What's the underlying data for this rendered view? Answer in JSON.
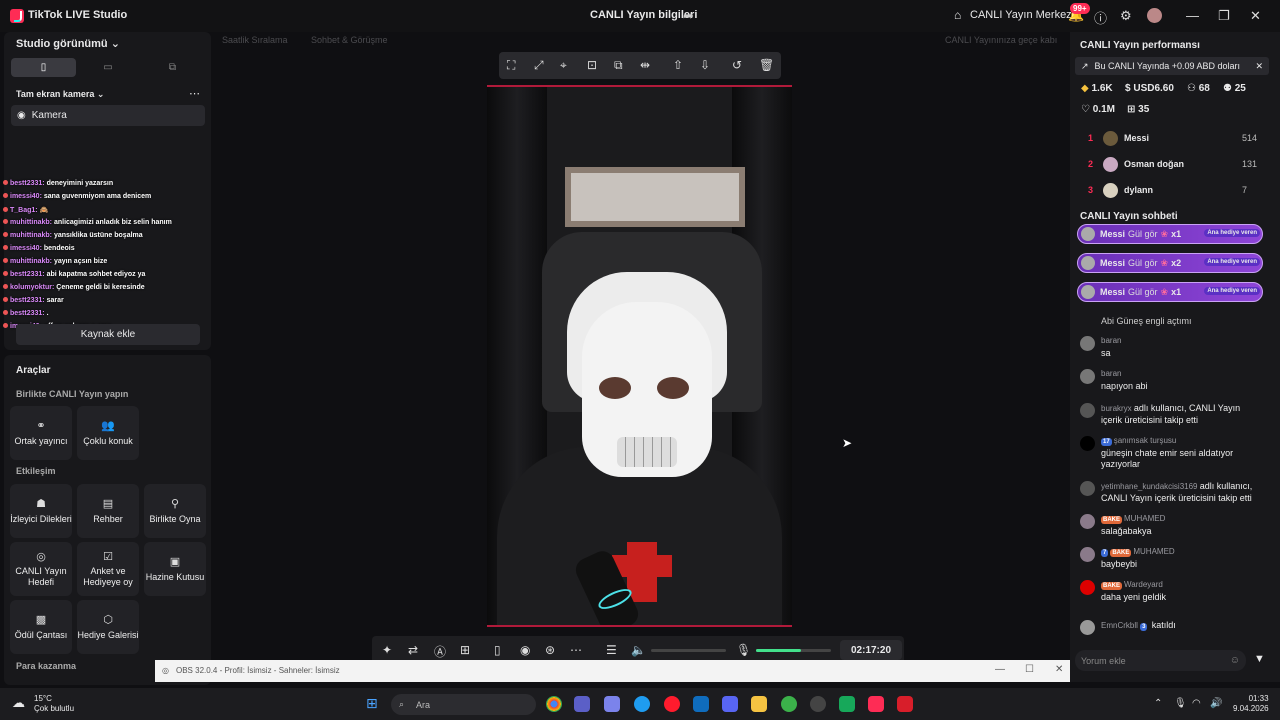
{
  "titlebar": {
    "app_name": "TikTok LIVE Studio",
    "center_title": "CANLI Yayın bilgileri",
    "home_label": "CANLI Yayın Merkezi",
    "notif_badge": "99+"
  },
  "left": {
    "studio_view": "Studio görünümü",
    "camera_mode": "Tam ekran kamera",
    "source_camera": "Kamera",
    "add_source": "Kaynak ekle",
    "overlay_chat": [
      {
        "user": "bestt2331:",
        "text": "deneyimini yazarsın"
      },
      {
        "user": "imessi40:",
        "text": "sana guvenmiyom ama denicem"
      },
      {
        "user": "T_Bag1:",
        "text": "🙈"
      },
      {
        "user": "muhittinakb:",
        "text": "anlicagimizi anladık biz selin hanım"
      },
      {
        "user": "muhittinakb:",
        "text": "yansıklika üstüne boşalma"
      },
      {
        "user": "imessi40:",
        "text": "bendeois"
      },
      {
        "user": "muhittinakb:",
        "text": "yayın açsın bize"
      },
      {
        "user": "bestt2331:",
        "text": "abi kapatma sohbet ediyoz ya"
      },
      {
        "user": "kolumyoktur:",
        "text": "Çeneme geldi bi keresinde"
      },
      {
        "user": "bestt2331:",
        "text": "sarar"
      },
      {
        "user": "bestt2331:",
        "text": "."
      },
      {
        "user": "imessi40:",
        "text": "off ya çok zor o ama"
      }
    ],
    "tools_title": "Araçlar",
    "sec_together": "Birlikte CANLI Yayın yapın",
    "co_host": "Ortak yayıncı",
    "multi_guest": "Çoklu konuk",
    "sec_interaction": "Etkileşim",
    "viewer_requests": "İzleyici Dilekleri",
    "guide": "Rehber",
    "play_together": "Birlikte Oyna",
    "live_goal": "CANLI Yayın Hedefi",
    "poll": "Anket ve Hediyeye oy",
    "treasure": "Hazine Kutusu",
    "reward_bag": "Ödül Çantası",
    "gift_gallery": "Hediye Galerisi",
    "sec_earn": "Para kazanma"
  },
  "center": {
    "ghost1": "Saatlik Sıralama",
    "ghost2": "Sohbet & Görüşme",
    "ghost3": "CANLI Yayınınıza geçe kabı",
    "timer": "02:17:20",
    "mic_level": 0.6
  },
  "obs": {
    "title": "OBS 32.0.4 - Profil: İsimsiz - Sahneler: İsimsiz"
  },
  "right": {
    "perf_title": "CANLI Yayın performansı",
    "perf_banner": "Bu CANLI Yayında +0.09 ABD doları",
    "stats": {
      "diamonds": "1.6K",
      "usd": "USD6.60",
      "viewers": "68",
      "followers": "25",
      "likes": "0.1M",
      "gifts": "35"
    },
    "ranking": [
      {
        "rank": "1",
        "name": "Messi",
        "score": "514"
      },
      {
        "rank": "2",
        "name": "Osman doğan",
        "score": "131"
      },
      {
        "rank": "3",
        "name": "dylann",
        "score": "7"
      }
    ],
    "chat_title": "CANLI Yayın sohbeti",
    "gift_rows": [
      {
        "user": "Messi",
        "action": "Gül gör",
        "count": "x1",
        "tag": "Ana hediye veren"
      },
      {
        "user": "Messi",
        "action": "Gül gör",
        "count": "x2",
        "tag": "Ana hediye veren"
      },
      {
        "user": "Messi",
        "action": "Gül gör",
        "count": "x1",
        "tag": "Ana hediye veren"
      }
    ],
    "partial_msg": "Abi Güneş engli açtımı",
    "messages": [
      {
        "user": "baran",
        "text": "sa"
      },
      {
        "user": "baran",
        "text": "napıyon abi"
      },
      {
        "user": "burakryx",
        "text": "adlı kullanıcı, CANLI Yayın",
        "text2": "içerik üreticisini takip etti"
      },
      {
        "badge": "17",
        "user": "şanımsak turşusu",
        "text": "güneşin chate emir seni aldatıyor",
        "text2": "yazıyorlar"
      },
      {
        "user": "yetimhane_kundakcisi3169",
        "text": "adlı kullanıcı,",
        "text2": "CANLI Yayın içerik üreticisini takip etti"
      },
      {
        "chip": "BAKE",
        "user": "MUHAMED",
        "text": "salağabakya"
      },
      {
        "badge": "7",
        "chip": "BAKE",
        "user": "MUHAMED",
        "text": "baybeybi"
      },
      {
        "chip": "BAKE",
        "user": "Wardeyard",
        "text": "daha yeni geldik"
      },
      {
        "user": "EmnCrkbll",
        "badge": "3",
        "text": "katıldı"
      }
    ],
    "comment_placeholder": "Yorum ekle"
  },
  "taskbar": {
    "temp": "15°C",
    "weather": "Çok bulutlu",
    "search": "Ara",
    "time": "01:33",
    "date": "9.04.2026"
  }
}
